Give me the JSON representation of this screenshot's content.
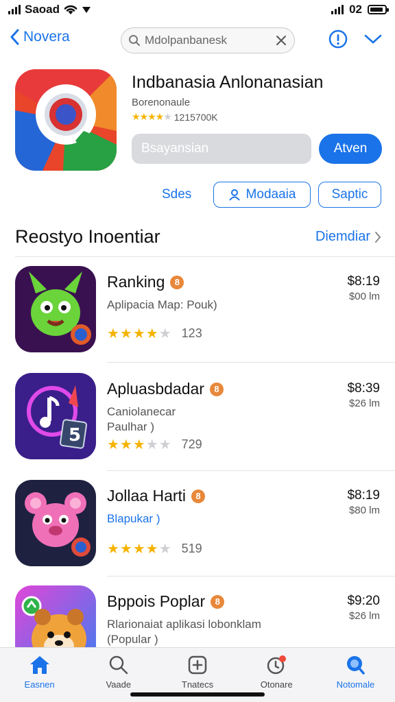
{
  "status_bar": {
    "carrier": "Saoad",
    "time": "02"
  },
  "nav": {
    "back_label": "Novera",
    "search_value": "Mdolpanbanesk"
  },
  "app": {
    "title": "Indbanasia Anlonanasian",
    "subtitle": "Borenonaule",
    "rating_count": "1215700K",
    "rating_stars": 4,
    "gray_button": "Bsayansian",
    "blue_button": "Atven",
    "link_label": "Sdes",
    "outline_1": "Modaaia",
    "outline_2": "Saptic"
  },
  "section": {
    "title": "Reostyo Inoentiar",
    "link": "Diemdiar"
  },
  "list": [
    {
      "name": "Ranking",
      "badge": "8",
      "desc1": "Aplipacia Map: Pouk)",
      "desc2": "",
      "rating": 3.5,
      "count": "123",
      "price": "$8:19",
      "price_sub": "$00 lm"
    },
    {
      "name": "Apluasbdadar",
      "badge": "8",
      "desc1": "Caniolanecar",
      "desc2": "Paulhar )",
      "rating": 3,
      "count": "729",
      "price": "$8:39",
      "price_sub": "$26 lm"
    },
    {
      "name": "Jollaa Harti",
      "badge": "8",
      "desc1": "Blapukar )",
      "desc2": "",
      "rating": 3.5,
      "count": "519",
      "price": "$8:19",
      "price_sub": "$80 lm"
    },
    {
      "name": "Bppois Poplar",
      "badge": "8",
      "desc1": "Rlarionaiat aplikasi lobonklam",
      "desc2": "(Popular )",
      "rating": 0,
      "count": "",
      "price": "$9:20",
      "price_sub": "$26 lm"
    }
  ],
  "tabs": [
    {
      "label": "Easnen",
      "icon": "home-icon",
      "active": true
    },
    {
      "label": "Vaade",
      "icon": "search-icon",
      "active": false
    },
    {
      "label": "Tnatecs",
      "icon": "add-box-icon",
      "active": false
    },
    {
      "label": "Otonare",
      "icon": "updates-icon",
      "active": false
    },
    {
      "label": "Notomale",
      "icon": "profile-icon",
      "active": true
    }
  ],
  "colors": {
    "accent": "#1a73e8",
    "star": "#f5b301",
    "badge": "#e8883a"
  }
}
